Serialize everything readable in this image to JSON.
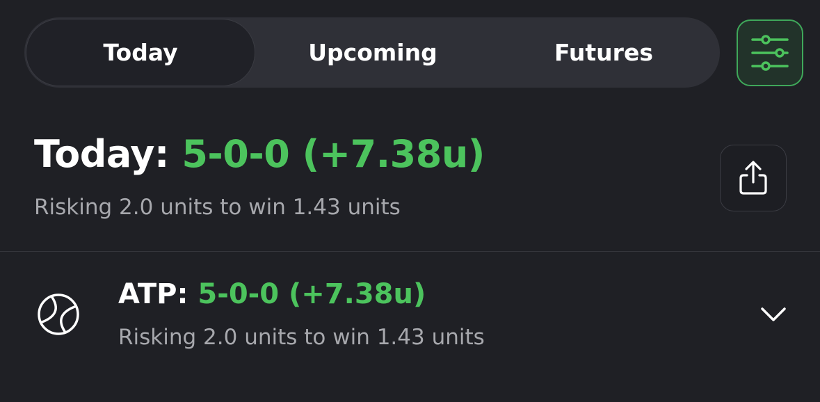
{
  "tabs": [
    {
      "label": "Today",
      "active": true
    },
    {
      "label": "Upcoming",
      "active": false
    },
    {
      "label": "Futures",
      "active": false
    }
  ],
  "filter_button": {
    "icon": "sliders-icon",
    "accent": "#4cc35d"
  },
  "summary": {
    "label": "Today:",
    "record": "5-0-0 (+7.38u)",
    "subtitle": "Risking 2.0 units to win 1.43 units"
  },
  "share_button": {
    "icon": "share-icon"
  },
  "leagues": [
    {
      "icon": "tennis-ball-icon",
      "label": "ATP:",
      "record": "5-0-0 (+7.38u)",
      "subtitle": "Risking 2.0 units to win 1.43 units",
      "expand_icon": "chevron-down-icon"
    }
  ],
  "colors": {
    "background": "#1f2025",
    "accent_green": "#4cc35d",
    "muted_text": "#a7a8ad"
  }
}
